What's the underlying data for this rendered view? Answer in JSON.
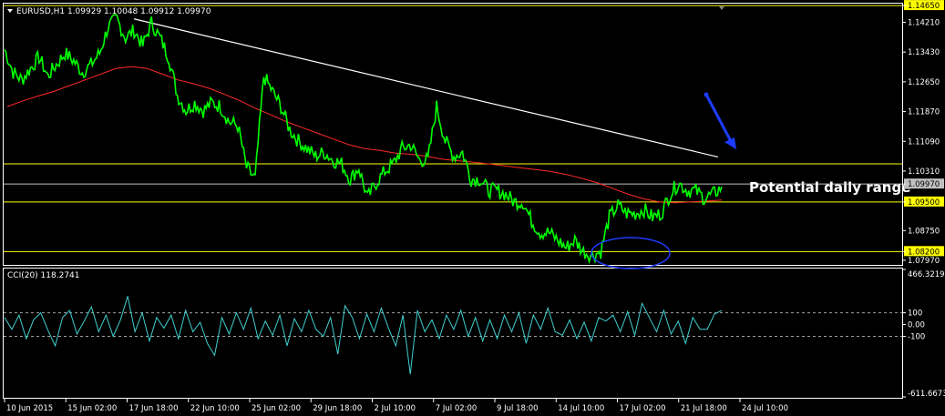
{
  "header": {
    "title": "EURUSD,H1  1.09929 1.10048 1.09912 1.09970",
    "dropdown_icon": "triangle-down-icon"
  },
  "annotation": {
    "text": "Potential daily range"
  },
  "colors": {
    "background": "#000000",
    "price": "#00ff00",
    "ma": "#ff2a2a",
    "trendline": "#ffffff",
    "hlines": "#ffff00",
    "current": "#c0c0c0",
    "arrow": "#1e3cff",
    "ellipse": "#1e3cff",
    "cci": "#40d0d0",
    "label_bg": "#ffff00",
    "axis": "#ffffff"
  },
  "chart_data": [
    {
      "type": "line",
      "title": "EURUSD,H1",
      "ohlc": {
        "open": 1.09929,
        "high": 1.10048,
        "low": 1.09912,
        "close": 1.0997
      },
      "ylim": [
        1.0785,
        1.147
      ],
      "y_ticks": [
        "1.14650",
        "1.14210",
        "1.13430",
        "1.12650",
        "1.11870",
        "1.11090",
        "1.10310",
        "1.09970",
        "1.09500",
        "1.08750",
        "1.08200",
        "1.07970"
      ],
      "x_ticks": [
        "10 Jun 2015",
        "15 Jun 02:00",
        "17 Jun 18:00",
        "22 Jun 10:00",
        "25 Jun 02:00",
        "29 Jun 18:00",
        "2 Jul 10:00",
        "7 Jul 02:00",
        "9 Jul 18:00",
        "14 Jul 10:00",
        "17 Jul 02:00",
        "21 Jul 18:00",
        "24 Jul 10:00"
      ],
      "horizontal_levels": [
        {
          "value": 1.1465,
          "label": "1.14650"
        },
        {
          "value": 1.105,
          "label": "1.10500"
        },
        {
          "value": 1.095,
          "label": "1.09500"
        },
        {
          "value": 1.082,
          "label": "1.08200"
        }
      ],
      "current_price": {
        "value": 1.0997,
        "label": "1.09970"
      },
      "series": [
        {
          "values": [
            1.135,
            1.129,
            1.127,
            1.13,
            1.133,
            1.128,
            1.131,
            1.134,
            1.132,
            1.129,
            1.131,
            1.134,
            1.141,
            1.143,
            1.138,
            1.14,
            1.136,
            1.142,
            1.138,
            1.133,
            1.123,
            1.119,
            1.121,
            1.119,
            1.121,
            1.12,
            1.116,
            1.115,
            1.104,
            1.101,
            1.128,
            1.124,
            1.12,
            1.114,
            1.111,
            1.109,
            1.107,
            1.108,
            1.106,
            1.105,
            1.101,
            1.104,
            1.096,
            1.1,
            1.103,
            1.105,
            1.109,
            1.11,
            1.106,
            1.106,
            1.12,
            1.111,
            1.107,
            1.108,
            1.101,
            1.101,
            1.098,
            1.098,
            1.097,
            1.095,
            1.095,
            1.09,
            1.087,
            1.087,
            1.085,
            1.083,
            1.085,
            1.082,
            1.081,
            1.082,
            1.091,
            1.094,
            1.092,
            1.092,
            1.093,
            1.091,
            1.092,
            1.097,
            1.1,
            1.098,
            1.098,
            1.096,
            1.097,
            1.099
          ]
        },
        {
          "name": "MA",
          "values": [
            1.12,
            1.1215,
            1.1228,
            1.124,
            1.1255,
            1.127,
            1.1285,
            1.13,
            1.1305,
            1.13,
            1.1285,
            1.127,
            1.126,
            1.1248,
            1.1232,
            1.1215,
            1.1195,
            1.1178,
            1.116,
            1.1145,
            1.113,
            1.1115,
            1.11,
            1.109,
            1.1085,
            1.1078,
            1.1075,
            1.107,
            1.1062,
            1.1058,
            1.1054,
            1.105,
            1.1045,
            1.104,
            1.1035,
            1.103,
            1.1022,
            1.1012,
            1.1,
            1.0985,
            1.097,
            1.0958,
            1.095,
            1.0948,
            1.095,
            1.0952,
            1.0955
          ]
        }
      ],
      "trendline": {
        "from": [
          0.145,
          1.143
        ],
        "to": [
          0.795,
          1.1068
        ]
      }
    },
    {
      "type": "line",
      "title": "CCI(20) 118.2741",
      "ylim": [
        -611.6673,
        466.3219
      ],
      "y_ticks": [
        "466.3219",
        "100",
        "0.00",
        "-100",
        "-611.6673"
      ],
      "levels": [
        100,
        -100
      ],
      "series": [
        {
          "name": "CCI(20)",
          "values": [
            60,
            -40,
            80,
            -120,
            40,
            100,
            -50,
            -180,
            60,
            120,
            -80,
            30,
            150,
            -60,
            80,
            -100,
            40,
            240,
            -60,
            100,
            -140,
            60,
            -30,
            80,
            -120,
            120,
            -60,
            20,
            -160,
            -260,
            60,
            -80,
            100,
            -40,
            140,
            -120,
            30,
            -90,
            80,
            -180,
            50,
            -60,
            120,
            -40,
            -100,
            60,
            -250,
            160,
            60,
            -120,
            90,
            -60,
            140,
            -30,
            -180,
            80,
            -420,
            120,
            -60,
            40,
            -120,
            80,
            -40,
            120,
            -100,
            60,
            -140,
            40,
            -120,
            80,
            -60,
            100,
            -160,
            80,
            -40,
            140,
            -60,
            -90,
            40,
            -120,
            20,
            -140,
            60,
            30,
            80,
            -60,
            110,
            -90,
            180,
            60,
            -60,
            120,
            -80,
            30,
            -160,
            60,
            -40,
            -40,
            90,
            118
          ]
        }
      ]
    }
  ]
}
